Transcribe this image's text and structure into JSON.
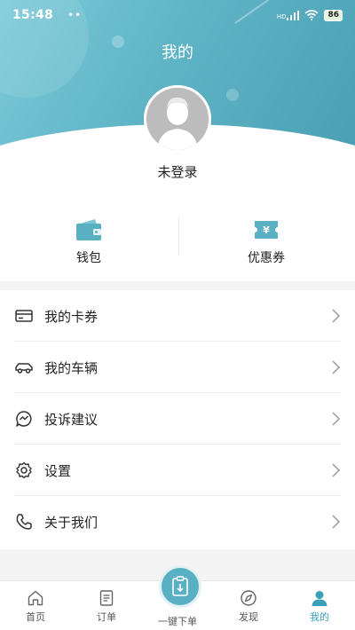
{
  "status_bar": {
    "time": "15:48",
    "dots": "••",
    "hd": "HD",
    "battery": "86"
  },
  "header": {
    "title": "我的"
  },
  "profile": {
    "login_text": "未登录"
  },
  "quick_actions": [
    {
      "label": "钱包",
      "icon": "wallet-icon"
    },
    {
      "label": "优惠券",
      "icon": "coupon-icon"
    }
  ],
  "menu": [
    {
      "label": "我的卡券",
      "icon": "card-icon"
    },
    {
      "label": "我的车辆",
      "icon": "car-icon"
    },
    {
      "label": "投诉建议",
      "icon": "chat-icon"
    },
    {
      "label": "设置",
      "icon": "gear-icon"
    },
    {
      "label": "关于我们",
      "icon": "phone-icon"
    }
  ],
  "tabs": [
    {
      "label": "首页",
      "icon": "home-icon"
    },
    {
      "label": "订单",
      "icon": "order-icon"
    },
    {
      "label": "一键下单",
      "icon": "quick-order-icon"
    },
    {
      "label": "发现",
      "icon": "compass-icon"
    },
    {
      "label": "我的",
      "icon": "user-icon",
      "active": true
    }
  ],
  "colors": {
    "accent": "#5ab0c3",
    "active_tab": "#3aa0b8"
  }
}
